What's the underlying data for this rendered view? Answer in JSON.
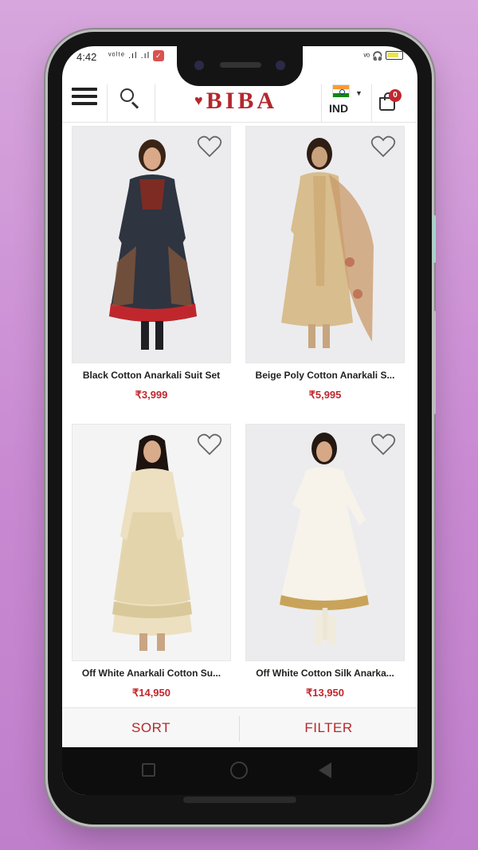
{
  "status": {
    "time": "4:42",
    "left_icons": "ᵛᵒˡᵗᵉ .ıl .ıl",
    "right_icons": "ᵛᵒ 🎧"
  },
  "header": {
    "brand": "BIBA",
    "country_code": "IND",
    "cart_count": "0"
  },
  "products": [
    {
      "name": "Black Cotton Anarkali Suit Set",
      "price": "₹3,999",
      "dress_color": "#2e3440",
      "accent": "#8c2a1f",
      "trim": "#c0272d"
    },
    {
      "name": "Beige Poly Cotton Anarkali S...",
      "price": "₹5,995",
      "dress_color": "#d8bd8e",
      "accent": "#c99a6a",
      "trim": "#b38a5a"
    },
    {
      "name": "Off White Anarkali Cotton Su...",
      "price": "₹14,950",
      "dress_color": "#ece0c0",
      "accent": "#d9c89a",
      "trim": "#c8b483"
    },
    {
      "name": "Off White Cotton Silk Anarka...",
      "price": "₹13,950",
      "dress_color": "#f7f3ea",
      "accent": "#e8e0cf",
      "trim": "#c9a35a"
    }
  ],
  "footer": {
    "sort_label": "SORT",
    "filter_label": "FILTER"
  },
  "colors": {
    "brand_red": "#b3282d",
    "price_red": "#c0272d"
  }
}
